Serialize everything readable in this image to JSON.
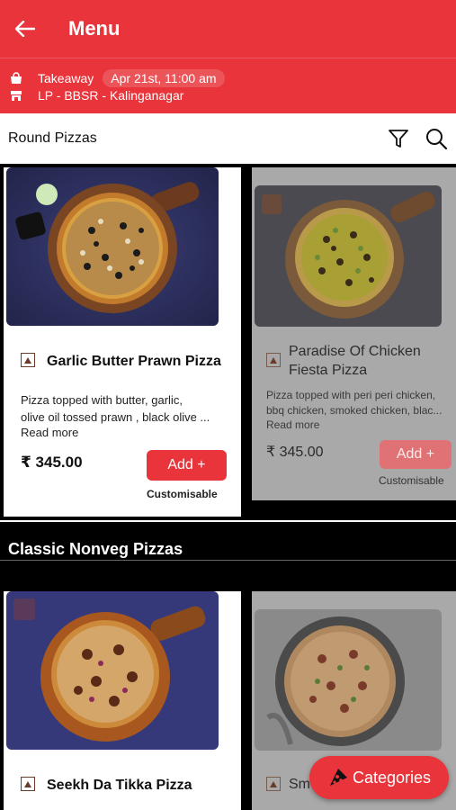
{
  "header": {
    "title": "Menu"
  },
  "order": {
    "mode": "Takeaway",
    "datetime": "Apr 21st, 11:00 am",
    "store": "LP - BBSR - Kalinganagar"
  },
  "category_bar": {
    "title": "Round Pizzas"
  },
  "items": [
    {
      "name": "Garlic Butter Prawn Pizza",
      "desc_line1": "Pizza topped with butter, garlic,",
      "desc_line2": "olive oil tossed prawn , black olive ...",
      "read_more": "Read more",
      "price": "₹ 345.00",
      "add_label": "Add +",
      "customisable": "Customisable"
    },
    {
      "name_line1": "Paradise Of Chicken",
      "name_line2": "Fiesta Pizza",
      "desc_line1": "Pizza topped with peri peri chicken,",
      "desc_line2": "bbq chicken, smoked chicken, blac...",
      "read_more": "Read more",
      "price": "₹ 345.00",
      "add_label": "Add +",
      "customisable": "Customisable"
    }
  ],
  "section2": {
    "title": "Classic Nonveg Pizzas"
  },
  "items2": [
    {
      "name": "Seekh Da Tikka Pizza"
    },
    {
      "name": "Sm"
    }
  ],
  "fab": {
    "label": "Categories"
  },
  "colors": {
    "brand": "#e8343a"
  }
}
